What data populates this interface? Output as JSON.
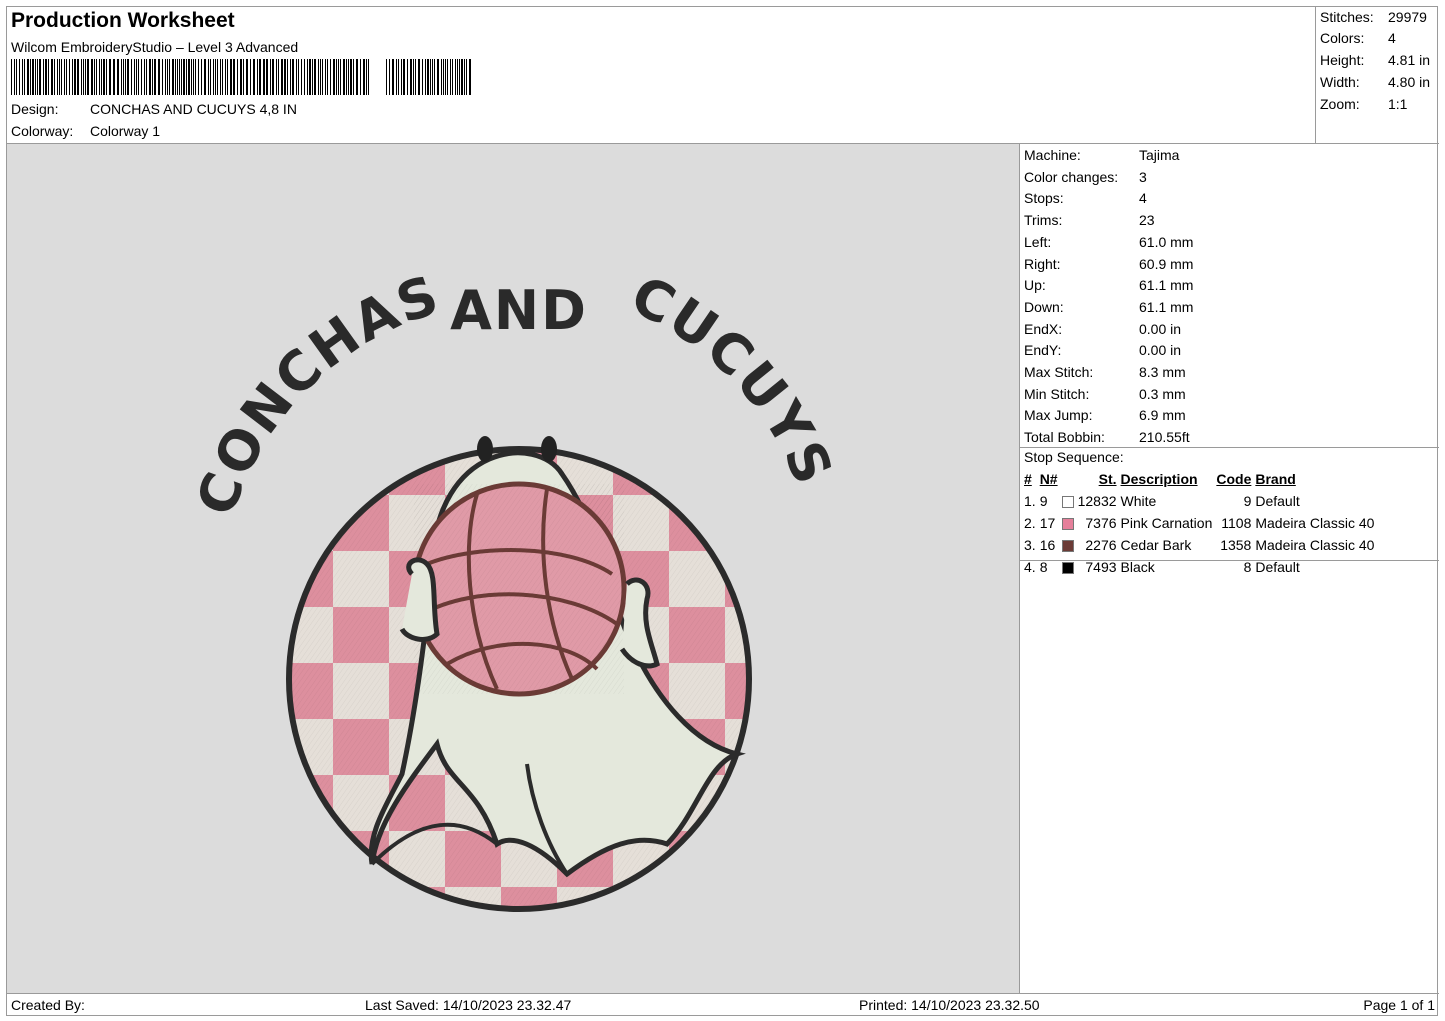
{
  "header": {
    "title": "Production Worksheet",
    "software": "Wilcom EmbroideryStudio – Level 3 Advanced",
    "design_label": "Design:",
    "design_value": "CONCHAS AND CUCUYS 4,8 IN",
    "colorway_label": "Colorway:",
    "colorway_value": "Colorway 1"
  },
  "summary": [
    {
      "label": "Stitches:",
      "value": "29979"
    },
    {
      "label": "Colors:",
      "value": "4"
    },
    {
      "label": "Height:",
      "value": "4.81 in"
    },
    {
      "label": "Width:",
      "value": "4.80 in"
    },
    {
      "label": "Zoom:",
      "value": "1:1"
    }
  ],
  "design_preview": {
    "text_left": "CONCHAS",
    "text_mid": "AND",
    "text_right": "CUCUYS"
  },
  "machine_info": [
    {
      "label": "Machine:",
      "value": "Tajima"
    },
    {
      "label": "Color changes:",
      "value": "3"
    },
    {
      "label": "Stops:",
      "value": "4"
    },
    {
      "label": "Trims:",
      "value": "23"
    },
    {
      "label": "Left:",
      "value": "61.0 mm"
    },
    {
      "label": "Right:",
      "value": "60.9 mm"
    },
    {
      "label": "Up:",
      "value": "61.1 mm"
    },
    {
      "label": "Down:",
      "value": "61.1 mm"
    },
    {
      "label": "EndX:",
      "value": "0.00 in"
    },
    {
      "label": "EndY:",
      "value": "0.00 in"
    },
    {
      "label": "Max Stitch:",
      "value": "8.3 mm"
    },
    {
      "label": "Min Stitch:",
      "value": "0.3 mm"
    },
    {
      "label": "Max Jump:",
      "value": "6.9 mm"
    },
    {
      "label": "Total Bobbin:",
      "value": "210.55ft"
    }
  ],
  "stop_sequence": {
    "title": "Stop Sequence:",
    "columns": {
      "idx": "#",
      "n": "N#",
      "st": "St.",
      "desc": "Description",
      "code": "Code",
      "brand": "Brand"
    },
    "rows": [
      {
        "idx": "1.",
        "n": "9",
        "color": "#ffffff",
        "st": "12832",
        "desc": "White",
        "code": "9",
        "brand": "Default"
      },
      {
        "idx": "2.",
        "n": "17",
        "color": "#e57f9a",
        "st": "7376",
        "desc": "Pink Carnation",
        "code": "1108",
        "brand": "Madeira Classic 40"
      },
      {
        "idx": "3.",
        "n": "16",
        "color": "#6b3b36",
        "st": "2276",
        "desc": "Cedar Bark",
        "code": "1358",
        "brand": "Madeira Classic 40"
      },
      {
        "idx": "4.",
        "n": "8",
        "color": "#000000",
        "st": "7493",
        "desc": "Black",
        "code": "8",
        "brand": "Default"
      }
    ]
  },
  "footer": {
    "created_by": "Created By:",
    "last_saved": "Last Saved: 14/10/2023 23.32.47",
    "printed": "Printed: 14/10/2023 23.32.50",
    "page": "Page 1 of 1"
  }
}
